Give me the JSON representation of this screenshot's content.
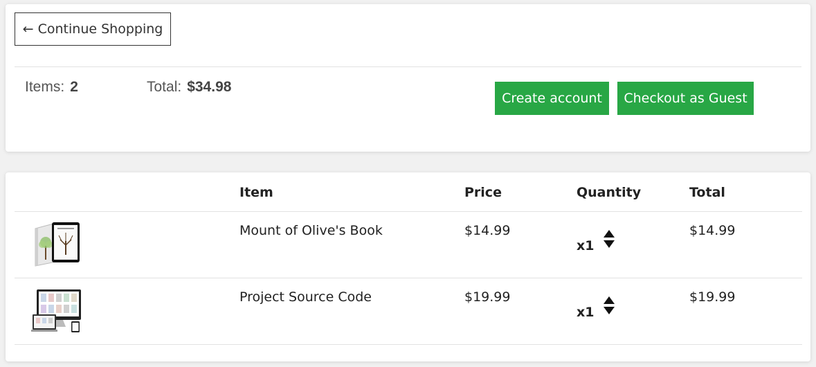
{
  "header": {
    "continue_label": "← Continue Shopping",
    "items_label": "Items:",
    "items_count": "2",
    "total_label": "Total:",
    "total_value": "$34.98",
    "create_account_label": "Create account",
    "guest_checkout_label": "Checkout as Guest",
    "accent_color": "#28a745"
  },
  "cart": {
    "columns": {
      "item": "Item",
      "price": "Price",
      "quantity": "Quantity",
      "total": "Total"
    },
    "rows": [
      {
        "name": "Mount of Olive's Book",
        "price": "$14.99",
        "quantity": "x1",
        "total": "$14.99",
        "thumbnail": "book-and-tablet-image"
      },
      {
        "name": "Project Source Code",
        "price": "$19.99",
        "quantity": "x1",
        "total": "$19.99",
        "thumbnail": "devices-screenshot-image"
      }
    ]
  }
}
